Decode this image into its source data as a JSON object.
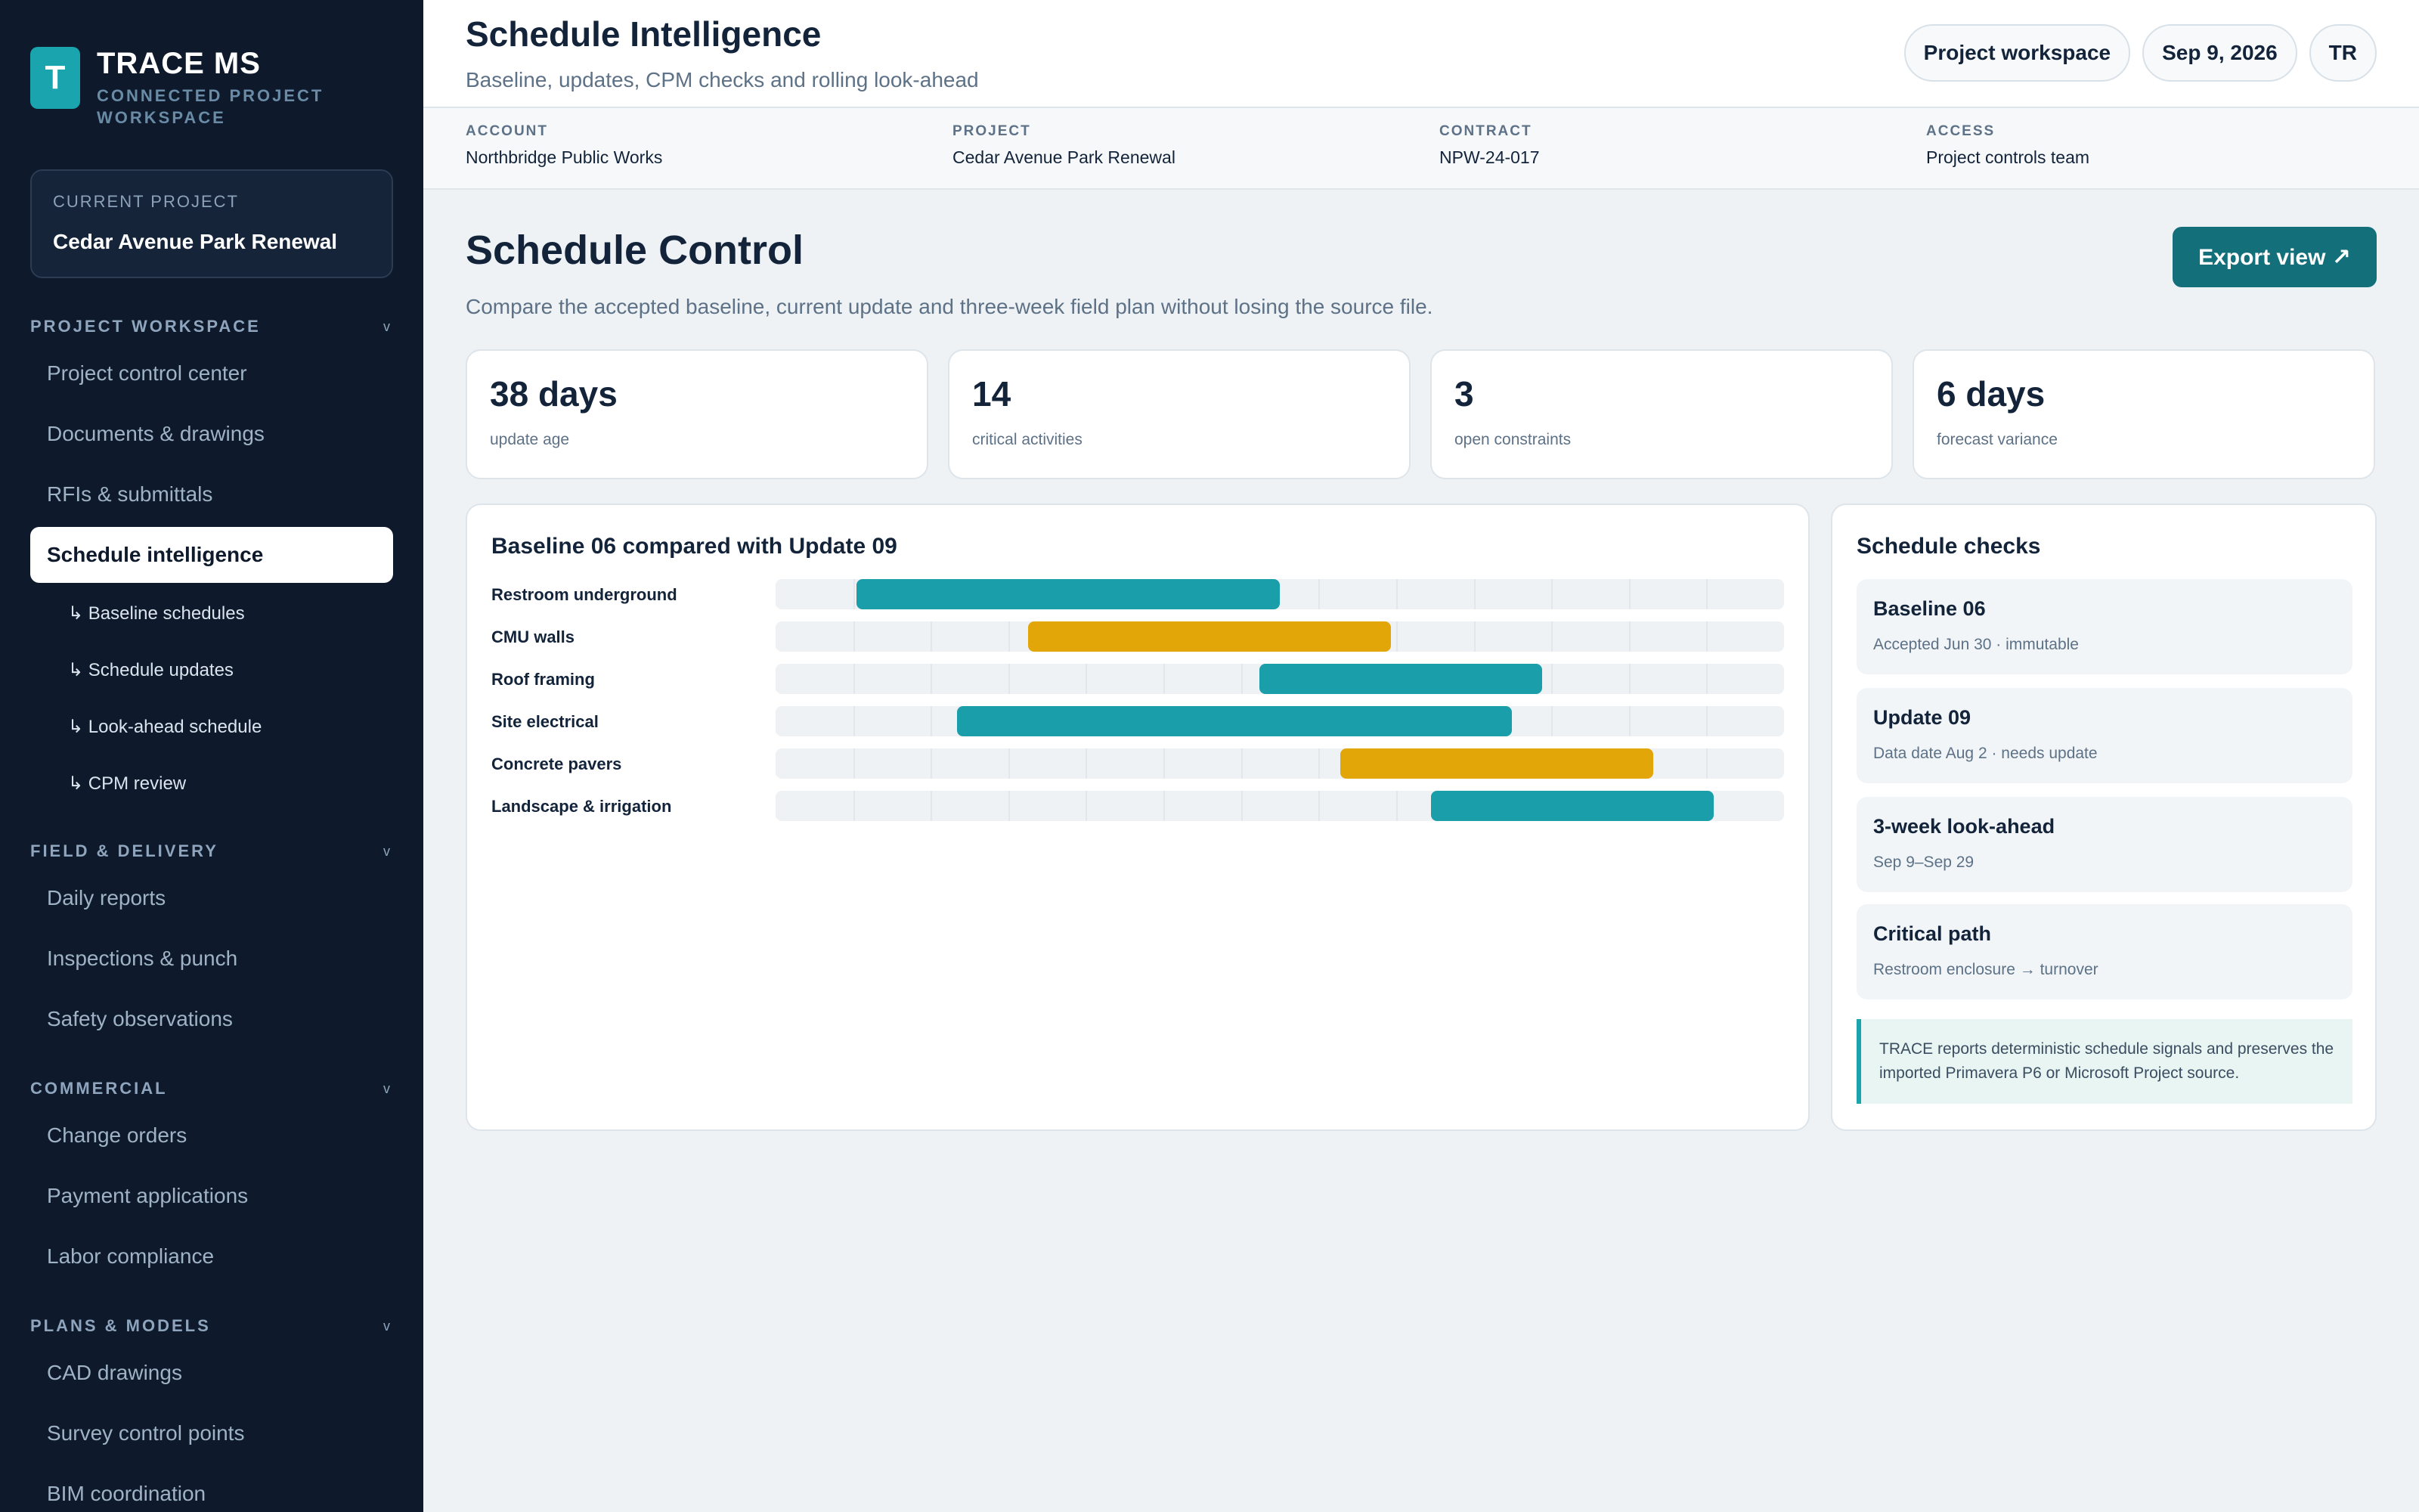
{
  "brand": {
    "logo_letter": "T",
    "name": "TRACE MS",
    "subtitle_line1": "CONNECTED PROJECT",
    "subtitle_line2": "WORKSPACE"
  },
  "current_project": {
    "label": "CURRENT PROJECT",
    "name": "Cedar Avenue Park Renewal"
  },
  "sidebar": {
    "sections": [
      {
        "title": "PROJECT WORKSPACE",
        "items": [
          "Project control center",
          "Documents & drawings",
          "RFIs & submittals",
          "Schedule intelligence"
        ],
        "active": "Schedule intelligence",
        "subitems": [
          "Baseline schedules",
          "Schedule updates",
          "Look-ahead schedule",
          "CPM review"
        ]
      },
      {
        "title": "FIELD & DELIVERY",
        "items": [
          "Daily reports",
          "Inspections & punch",
          "Safety observations"
        ]
      },
      {
        "title": "COMMERCIAL",
        "items": [
          "Change orders",
          "Payment applications",
          "Labor compliance"
        ]
      },
      {
        "title": "PLANS & MODELS",
        "items": [
          "CAD drawings",
          "Survey control points",
          "BIM coordination"
        ]
      }
    ],
    "sub_prefix": "↳",
    "chevron": "v"
  },
  "header": {
    "title": "Schedule Intelligence",
    "subtitle": "Baseline, updates, CPM checks and rolling look-ahead",
    "pill_workspace": "Project workspace",
    "pill_date": "Sep 9, 2026",
    "pill_avatar": "TR"
  },
  "meta": [
    {
      "key": "ACCOUNT",
      "value": "Northbridge Public Works"
    },
    {
      "key": "PROJECT",
      "value": "Cedar Avenue Park Renewal"
    },
    {
      "key": "CONTRACT",
      "value": "NPW-24-017"
    },
    {
      "key": "ACCESS",
      "value": "Project controls team"
    }
  ],
  "main": {
    "title": "Schedule Control",
    "description": "Compare the accepted baseline, current update and three-week field plan without losing the source file.",
    "export_label": "Export view ↗"
  },
  "kpis": [
    {
      "value": "38 days",
      "label": "update age"
    },
    {
      "value": "14",
      "label": "critical activities"
    },
    {
      "value": "3",
      "label": "open constraints"
    },
    {
      "value": "6 days",
      "label": "forecast variance"
    }
  ],
  "gantt": {
    "title": "Baseline 06 compared with Update 09",
    "rows": [
      {
        "label": "Restroom underground",
        "start": 0.08,
        "end": 0.5,
        "status": "teal"
      },
      {
        "label": "CMU walls",
        "start": 0.25,
        "end": 0.61,
        "status": "amber"
      },
      {
        "label": "Roof framing",
        "start": 0.48,
        "end": 0.76,
        "status": "teal"
      },
      {
        "label": "Site electrical",
        "start": 0.18,
        "end": 0.73,
        "status": "teal"
      },
      {
        "label": "Concrete pavers",
        "start": 0.56,
        "end": 0.87,
        "status": "amber"
      },
      {
        "label": "Landscape & irrigation",
        "start": 0.65,
        "end": 0.93,
        "status": "teal"
      }
    ],
    "colors": {
      "teal": "#1a9ea9",
      "amber": "#e2a608"
    }
  },
  "checks": {
    "title": "Schedule checks",
    "items": [
      {
        "title": "Baseline 06",
        "sub": "Accepted Jun 30 · immutable"
      },
      {
        "title": "Update 09",
        "sub": "Data date Aug 2 · needs update"
      },
      {
        "title": "3-week look-ahead",
        "sub": "Sep 9–Sep 29"
      },
      {
        "title": "Critical path",
        "sub": "Restroom enclosure → turnover"
      }
    ],
    "note": "TRACE reports deterministic schedule signals and preserves the imported Primavera P6 or Microsoft Project source."
  }
}
